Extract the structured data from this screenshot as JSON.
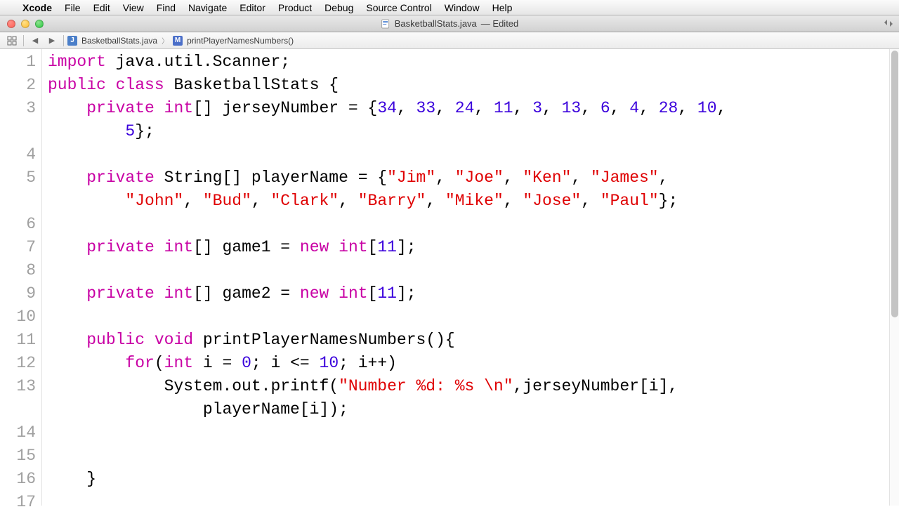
{
  "menubar": {
    "app": "Xcode",
    "items": [
      "File",
      "Edit",
      "View",
      "Find",
      "Navigate",
      "Editor",
      "Product",
      "Debug",
      "Source Control",
      "Window",
      "Help"
    ]
  },
  "titlebar": {
    "filename": "BasketballStats.java",
    "status": "— Edited"
  },
  "breadcrumb": {
    "file": "BasketballStats.java",
    "symbol": "printPlayerNamesNumbers()"
  },
  "gutter_lines": [
    "1",
    "2",
    "3",
    "",
    "4",
    "5",
    "",
    "6",
    "7",
    "8",
    "9",
    "10",
    "11",
    "12",
    "13",
    "",
    "14",
    "15",
    "16",
    "17"
  ],
  "code": {
    "l1_a": "import",
    "l1_b": " java.util.Scanner;",
    "l2_a": "public",
    "l2_b": "class",
    "l2_c": " BasketballStats {",
    "l3_a": "private",
    "l3_b": "int",
    "l3_c": "[] jerseyNumber = {",
    "jersey": [
      "34",
      "33",
      "24",
      "11",
      "3",
      "13",
      "6",
      "4",
      "28",
      "10",
      "5"
    ],
    "l3_end": "};",
    "l5_a": "private",
    "l5_b": " String[] playerName = {",
    "names": [
      "\"Jim\"",
      "\"Joe\"",
      "\"Ken\"",
      "\"James\"",
      "\"John\"",
      "\"Bud\"",
      "\"Clark\"",
      "\"Barry\"",
      "\"Mike\"",
      "\"Jose\"",
      "\"Paul\""
    ],
    "l5_end": "};",
    "l7_a": "private",
    "l7_b": "int",
    "l7_c": "[] game1 = ",
    "l7_d": "new",
    "l7_e": "int",
    "l7_f": "[",
    "l7_g": "11",
    "l7_h": "];",
    "l9_a": "private",
    "l9_b": "int",
    "l9_c": "[] game2 = ",
    "l9_d": "new",
    "l9_e": "int",
    "l9_f": "[",
    "l9_g": "11",
    "l9_h": "];",
    "l11_a": "public",
    "l11_b": "void",
    "l11_c": " printPlayerNamesNumbers(){",
    "l12_a": "for",
    "l12_b": "(",
    "l12_c": "int",
    "l12_d": " i = ",
    "l12_e": "0",
    "l12_f": "; i <= ",
    "l12_g": "10",
    "l12_h": "; i++)",
    "l13_a": "System.out.printf(",
    "l13_b": "\"Number %d: %s \\n\"",
    "l13_c": ",jerseyNumber[i],",
    "l13w_a": "playerName[i]);",
    "l16": "}"
  }
}
